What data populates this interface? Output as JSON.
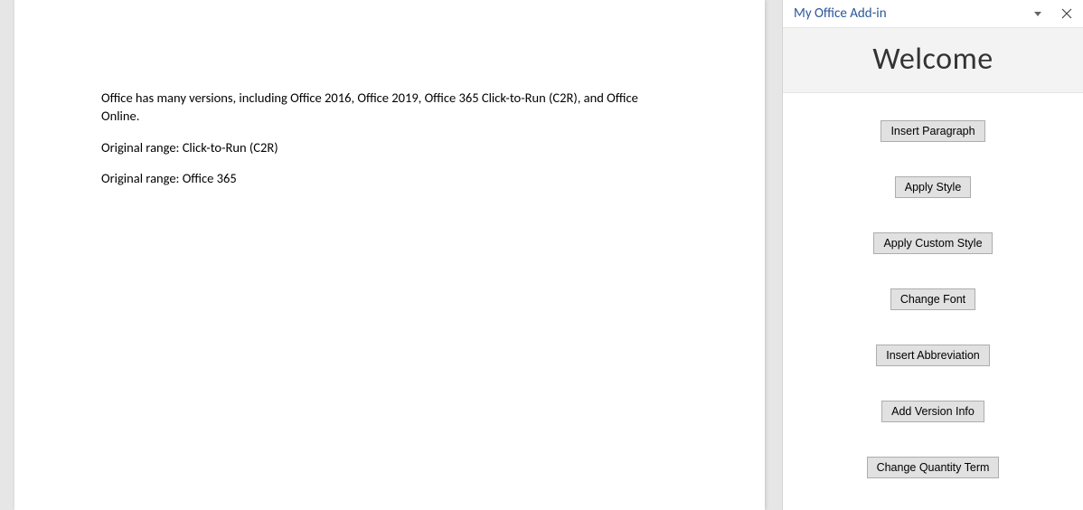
{
  "document": {
    "paragraphs": [
      "Office has many versions, including Office 2016, Office 2019, Office 365 Click-to-Run (C2R), and Office Online.",
      "Original range: Click-to-Run (C2R)",
      "Original range: Office 365"
    ]
  },
  "taskpane": {
    "title": "My Office Add-in",
    "welcome_heading": "Welcome",
    "buttons": {
      "insert_paragraph": "Insert Paragraph",
      "apply_style": "Apply Style",
      "apply_custom_style": "Apply Custom Style",
      "change_font": "Change Font",
      "insert_abbreviation": "Insert Abbreviation",
      "add_version_info": "Add Version Info",
      "change_quantity_term": "Change Quantity Term"
    }
  }
}
